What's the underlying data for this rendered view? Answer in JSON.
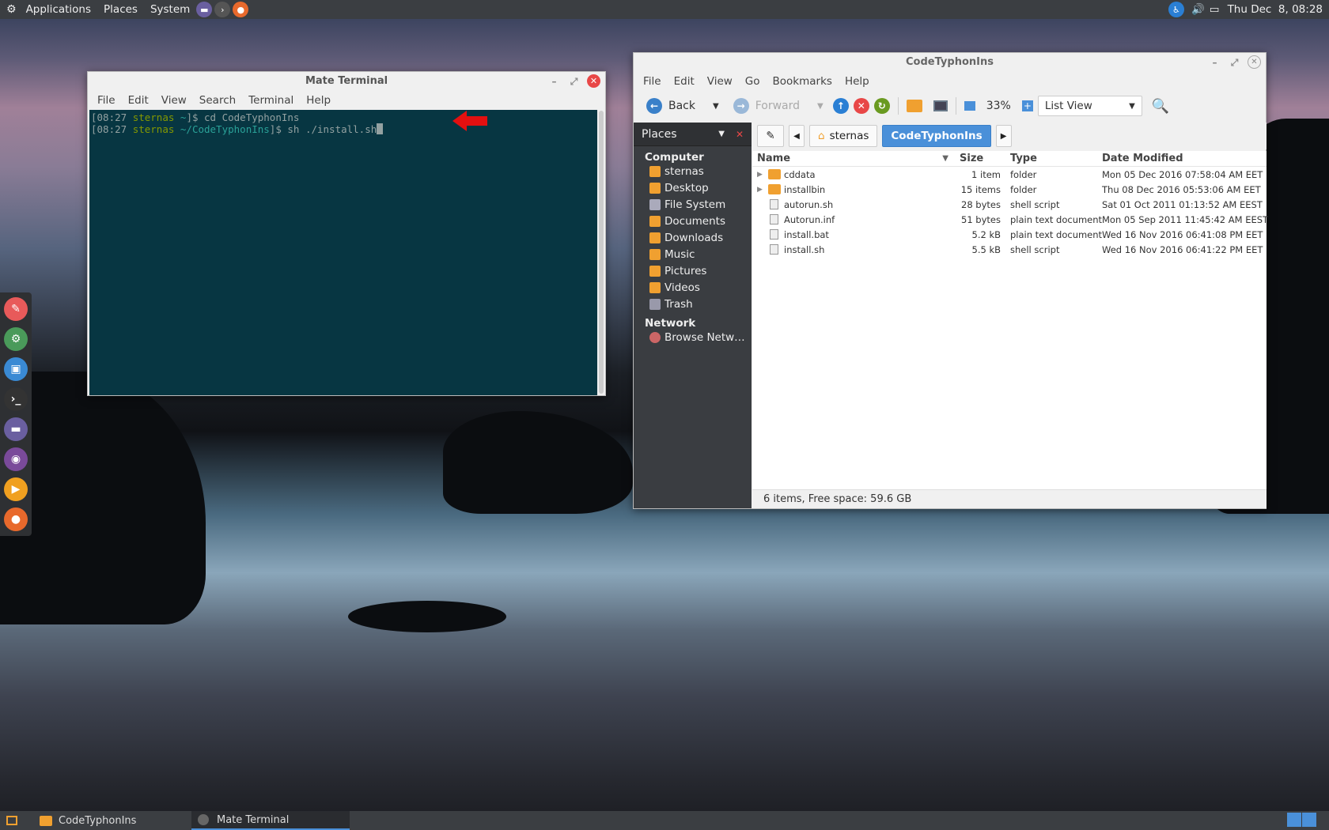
{
  "top_panel": {
    "menus": [
      "Applications",
      "Places",
      "System"
    ],
    "clock": "Thu Dec  8, 08:28"
  },
  "terminal": {
    "title": "Mate Terminal",
    "menus": [
      "File",
      "Edit",
      "View",
      "Search",
      "Terminal",
      "Help"
    ],
    "line1": {
      "time": "[08:27 ",
      "user": "sternas ",
      "path": "~",
      "end": "]$ cd CodeTyphonIns"
    },
    "line2": {
      "time": "[08:27 ",
      "user": "sternas ",
      "path": "~/CodeTyphonIns",
      "end": "]$ sh ./install.sh"
    }
  },
  "file_manager": {
    "title": "CodeTyphonIns",
    "menus": [
      "File",
      "Edit",
      "View",
      "Go",
      "Bookmarks",
      "Help"
    ],
    "toolbar": {
      "back": "Back",
      "forward": "Forward",
      "zoom": "33%",
      "view": "List View"
    },
    "sidebar": {
      "header": "Places",
      "computer_label": "Computer",
      "items": [
        "sternas",
        "Desktop",
        "File System",
        "Documents",
        "Downloads",
        "Music",
        "Pictures",
        "Videos",
        "Trash"
      ],
      "network_label": "Network",
      "network_items": [
        "Browse Netw…"
      ]
    },
    "path": [
      "sternas",
      "CodeTyphonIns"
    ],
    "columns": [
      "Name",
      "Size",
      "Type",
      "Date Modified"
    ],
    "rows": [
      {
        "name": "cddata",
        "size": "1 item",
        "type": "folder",
        "date": "Mon 05 Dec 2016 07:58:04 AM EET"
      },
      {
        "name": "installbin",
        "size": "15 items",
        "type": "folder",
        "date": "Thu 08 Dec 2016 05:53:06 AM EET"
      },
      {
        "name": "autorun.sh",
        "size": "28 bytes",
        "type": "shell script",
        "date": "Sat 01 Oct 2011 01:13:52 AM EEST"
      },
      {
        "name": "Autorun.inf",
        "size": "51 bytes",
        "type": "plain text document",
        "date": "Mon 05 Sep 2011 11:45:42 AM EEST"
      },
      {
        "name": "install.bat",
        "size": "5.2 kB",
        "type": "plain text document",
        "date": "Wed 16 Nov 2016 06:41:08 PM EET"
      },
      {
        "name": "install.sh",
        "size": "5.5 kB",
        "type": "shell script",
        "date": "Wed 16 Nov 2016 06:41:22 PM EET"
      }
    ],
    "status": "6 items, Free space: 59.6 GB"
  },
  "taskbar": [
    "CodeTyphonIns",
    "Mate Terminal"
  ]
}
